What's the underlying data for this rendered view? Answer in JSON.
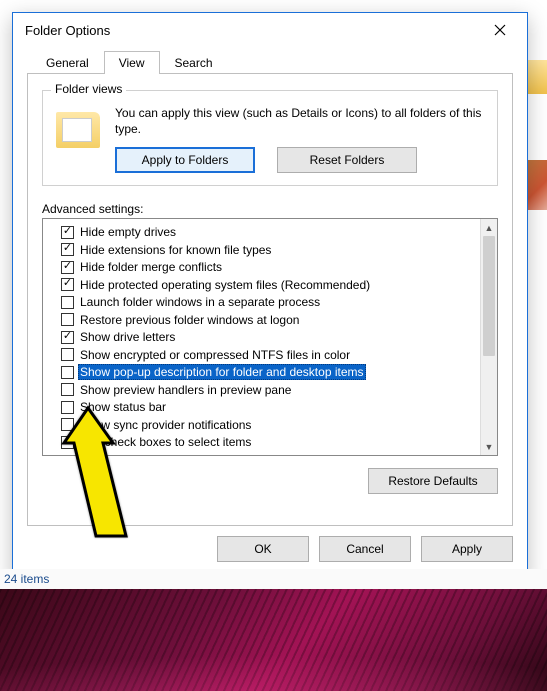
{
  "window": {
    "title": "Folder Options"
  },
  "tabs": {
    "general": "General",
    "view": "View",
    "search": "Search",
    "active": "view"
  },
  "folder_views": {
    "group_title": "Folder views",
    "description": "You can apply this view (such as Details or Icons) to all folders of this type.",
    "apply_btn": "Apply to Folders",
    "reset_btn": "Reset Folders"
  },
  "advanced": {
    "label": "Advanced settings:",
    "items": [
      {
        "label": "Hide empty drives",
        "checked": true,
        "selected": false
      },
      {
        "label": "Hide extensions for known file types",
        "checked": true,
        "selected": false
      },
      {
        "label": "Hide folder merge conflicts",
        "checked": true,
        "selected": false
      },
      {
        "label": "Hide protected operating system files (Recommended)",
        "checked": true,
        "selected": false
      },
      {
        "label": "Launch folder windows in a separate process",
        "checked": false,
        "selected": false
      },
      {
        "label": "Restore previous folder windows at logon",
        "checked": false,
        "selected": false
      },
      {
        "label": "Show drive letters",
        "checked": true,
        "selected": false
      },
      {
        "label": "Show encrypted or compressed NTFS files in color",
        "checked": false,
        "selected": false
      },
      {
        "label": "Show pop-up description for folder and desktop items",
        "checked": false,
        "selected": true
      },
      {
        "label": "Show preview handlers in preview pane",
        "checked": false,
        "selected": false
      },
      {
        "label": "Show status bar",
        "checked": false,
        "selected": false
      },
      {
        "label": "Show sync provider notifications",
        "checked": false,
        "selected": false
      },
      {
        "label": "Use check boxes to select items",
        "checked": false,
        "selected": false
      }
    ],
    "restore_defaults_btn": "Restore Defaults"
  },
  "dialog_buttons": {
    "ok": "OK",
    "cancel": "Cancel",
    "apply": "Apply"
  },
  "status_bar": {
    "text": "24 items"
  }
}
